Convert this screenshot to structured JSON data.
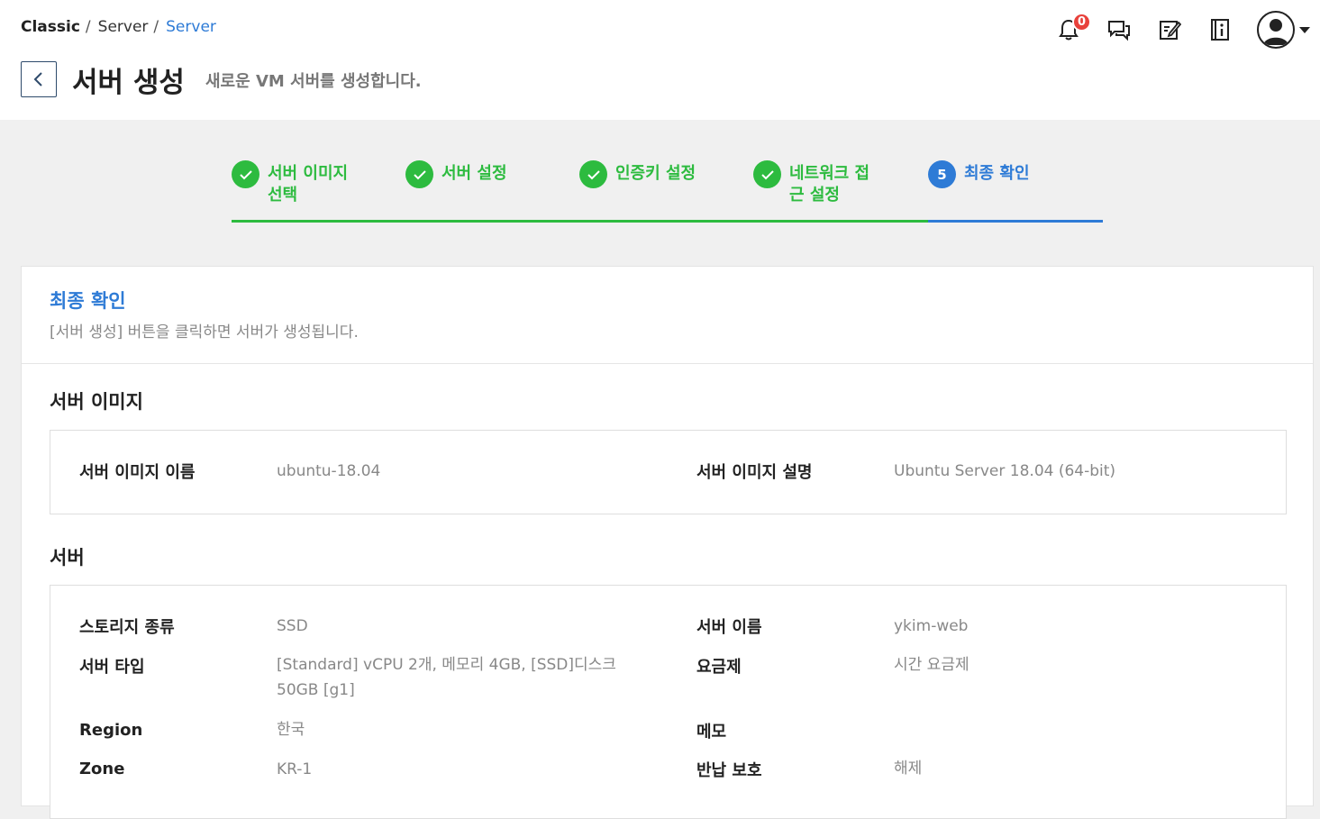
{
  "breadcrumb": {
    "item1": "Classic",
    "sep1": "/",
    "item2": "Server",
    "sep2": "/",
    "item3": "Server"
  },
  "header": {
    "title": "서버 생성",
    "subtitle": "새로운 VM 서버를 생성합니다.",
    "notification_count": "0"
  },
  "steps": [
    {
      "label": "서버 이미지 선택",
      "status": "done"
    },
    {
      "label": "서버 설정",
      "status": "done"
    },
    {
      "label": "인증키 설정",
      "status": "done"
    },
    {
      "label": "네트워크 접근 설정",
      "status": "done"
    },
    {
      "number": "5",
      "label": "최종 확인",
      "status": "active"
    }
  ],
  "card": {
    "title": "최종 확인",
    "description": "[서버 생성] 버튼을 클릭하면 서버가 생성됩니다."
  },
  "image_section": {
    "title": "서버 이미지",
    "image_name_label": "서버 이미지 이름",
    "image_name_value": "ubuntu-18.04",
    "image_desc_label": "서버 이미지 설명",
    "image_desc_value": "Ubuntu Server 18.04 (64-bit)"
  },
  "server_section": {
    "title": "서버",
    "storage_label": "스토리지 종류",
    "storage_value": "SSD",
    "server_name_label": "서버 이름",
    "server_name_value": "ykim-web",
    "server_type_label": "서버 타입",
    "server_type_value": "[Standard] vCPU 2개, 메모리 4GB, [SSD]디스크 50GB [g1]",
    "pricing_label": "요금제",
    "pricing_value": "시간 요금제",
    "region_label": "Region",
    "region_value": "한국",
    "memo_label": "메모",
    "memo_value": "",
    "zone_label": "Zone",
    "zone_value": "KR-1",
    "return_protect_label": "반납 보호",
    "return_protect_value": "해제"
  },
  "colors": {
    "accent_blue": "#2e7bd6",
    "success_green": "#2dbb3f",
    "badge_red": "#e8413b"
  }
}
